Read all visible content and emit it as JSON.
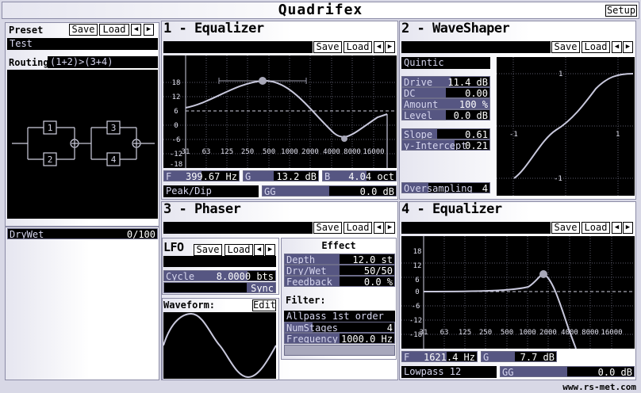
{
  "app": {
    "title": "Quadrifex",
    "setup_label": "Setup",
    "footer": "www.rs-met.com"
  },
  "preset": {
    "label": "Preset",
    "save": "Save",
    "load": "Load",
    "name": "Test"
  },
  "routing": {
    "label": "Routing:",
    "value": "(1+2)>(3+4)",
    "slots": [
      "1",
      "2",
      "3",
      "4"
    ]
  },
  "drywet": {
    "label": "DryWet",
    "value": "0/100",
    "fraction": 0.0
  },
  "eq1": {
    "title": "1 - Equalizer",
    "save": "Save",
    "load": "Load",
    "y_ticks": [
      "18",
      "12",
      "6",
      "0",
      "-6",
      "-12",
      "-18"
    ],
    "x_ticks": [
      "31",
      "63",
      "125",
      "250",
      "500",
      "1000",
      "2000",
      "4000",
      "8000",
      "16000"
    ],
    "freq_label": "F",
    "freq_value": "399.67 Hz",
    "gain_label": "G",
    "gain_value": "13.2 dB",
    "bw_label": "B",
    "bw_value": "4.04 oct",
    "mode": "Peak/Dip",
    "gg_label": "GG",
    "gg_value": "0.0 dB"
  },
  "waveshaper": {
    "title": "2 - WaveShaper",
    "save": "Save",
    "load": "Load",
    "curve": "Quintic",
    "params": [
      {
        "label": "Drive",
        "value": "11.4 dB",
        "fraction": 0.55
      },
      {
        "label": "DC",
        "value": "0.00",
        "fraction": 0.5
      },
      {
        "label": "Amount",
        "value": "100 %",
        "fraction": 1.0
      },
      {
        "label": "Level",
        "value": "0.0 dB",
        "fraction": 0.5
      }
    ],
    "slope": {
      "label": "Slope",
      "value": "0.61",
      "fraction": 0.4
    },
    "intercept": {
      "label": "y-Intercept",
      "value": "0.21",
      "fraction": 0.6
    },
    "oversampling_label": "Oversampling",
    "oversampling_value": "4",
    "ticks": {
      "y_top": "1",
      "y_bottom": "-1",
      "x_left": "-1",
      "x_right": "1"
    }
  },
  "phaser": {
    "title": "3 - Phaser",
    "save": "Save",
    "load": "Load",
    "lfo": {
      "title": "LFO",
      "save": "Save",
      "load": "Load",
      "cycle_label": "Cycle",
      "cycle_value": "8.0000 bts",
      "sync": "Sync",
      "waveform_label": "Waveform:",
      "edit": "Edit"
    },
    "effect": {
      "title": "Effect",
      "params": [
        {
          "label": "Depth",
          "value": "12.0 st",
          "fraction": 0.5
        },
        {
          "label": "Dry/Wet",
          "value": "50/50",
          "fraction": 0.5
        },
        {
          "label": "Feedback",
          "value": "0.0 %",
          "fraction": 0.5
        }
      ]
    },
    "filter": {
      "title": "Filter:",
      "type": "Allpass 1st order",
      "numstages_label": "NumStages",
      "numstages_value": "4",
      "frequency_label": "Frequency",
      "frequency_value": "1000.0 Hz"
    }
  },
  "eq4": {
    "title": "4 - Equalizer",
    "save": "Save",
    "load": "Load",
    "y_ticks": [
      "18",
      "12",
      "6",
      "0",
      "-6",
      "-12",
      "-18"
    ],
    "x_ticks": [
      "31",
      "63",
      "125",
      "250",
      "500",
      "1000",
      "2000",
      "4000",
      "8000",
      "16000"
    ],
    "freq_label": "F",
    "freq_value": "1621.4 Hz",
    "gain_label": "G",
    "gain_value": "7.7 dB",
    "mode": "Lowpass 12",
    "gg_label": "GG",
    "gg_value": "0.0 dB"
  },
  "colors": {
    "panel_bg": "#ffffff",
    "frame": "#d8d8e6",
    "bar_fill": "#565682",
    "curve": "#c8c8dc",
    "accent_text": "#d6d6ee"
  }
}
